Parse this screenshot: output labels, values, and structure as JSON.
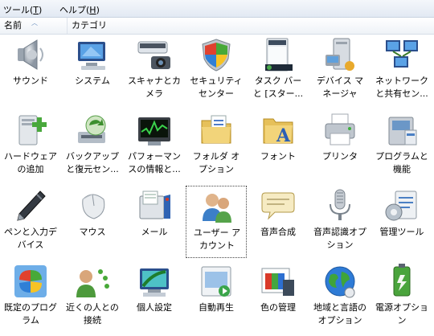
{
  "menubar": {
    "items": [
      {
        "label": "ツール(",
        "key": "T",
        "suffix": ")"
      },
      {
        "label": "ヘルプ(",
        "key": "H",
        "suffix": ")"
      }
    ]
  },
  "columns": {
    "name": "名前",
    "category": "カテゴリ"
  },
  "items": [
    {
      "line1": "サウンド",
      "line2": "",
      "icon": "speaker-icon"
    },
    {
      "line1": "システム",
      "line2": "",
      "icon": "computer-icon"
    },
    {
      "line1": "スキャナとカ",
      "line2": "メラ",
      "icon": "scanner-camera-icon"
    },
    {
      "line1": "セキュリティ",
      "line2": "センター",
      "icon": "security-shield-icon"
    },
    {
      "line1": "タスク バー",
      "line2": "と [スター...",
      "icon": "taskbar-icon"
    },
    {
      "line1": "デバイス マ",
      "line2": "ネージャ",
      "icon": "device-manager-icon"
    },
    {
      "line1": "ネットワーク",
      "line2": "と共有セン...",
      "icon": "network-icon"
    },
    {
      "line1": "ハードウェア",
      "line2": "の追加",
      "icon": "add-hardware-icon"
    },
    {
      "line1": "バックアップ",
      "line2": "と復元セン...",
      "icon": "backup-icon"
    },
    {
      "line1": "パフォーマン",
      "line2": "スの情報と...",
      "icon": "performance-icon"
    },
    {
      "line1": "フォルダ オ",
      "line2": "プション",
      "icon": "folder-options-icon"
    },
    {
      "line1": "フォント",
      "line2": "",
      "icon": "fonts-icon"
    },
    {
      "line1": "プリンタ",
      "line2": "",
      "icon": "printer-icon"
    },
    {
      "line1": "プログラムと",
      "line2": "機能",
      "icon": "programs-icon"
    },
    {
      "line1": "ペンと入力デ",
      "line2": "バイス",
      "icon": "pen-icon"
    },
    {
      "line1": "マウス",
      "line2": "",
      "icon": "mouse-icon"
    },
    {
      "line1": "メール",
      "line2": "",
      "icon": "mail-icon"
    },
    {
      "line1": "ユーザー ア",
      "line2": "カウント",
      "icon": "user-accounts-icon",
      "selected": true
    },
    {
      "line1": "音声合成",
      "line2": "",
      "icon": "speech-icon"
    },
    {
      "line1": "音声認識オプ",
      "line2": "ション",
      "icon": "microphone-icon"
    },
    {
      "line1": "管理ツール",
      "line2": "",
      "icon": "admin-tools-icon"
    },
    {
      "line1": "既定のプログ",
      "line2": "ラム",
      "icon": "default-programs-icon"
    },
    {
      "line1": "近くの人との",
      "line2": "接続",
      "icon": "people-near-me-icon"
    },
    {
      "line1": "個人設定",
      "line2": "",
      "icon": "personalization-icon"
    },
    {
      "line1": "自動再生",
      "line2": "",
      "icon": "autoplay-icon"
    },
    {
      "line1": "色の管理",
      "line2": "",
      "icon": "color-management-icon"
    },
    {
      "line1": "地域と言語の",
      "line2": "オプション",
      "icon": "globe-icon"
    },
    {
      "line1": "電源オプショ",
      "line2": "ン",
      "icon": "power-options-icon"
    }
  ]
}
